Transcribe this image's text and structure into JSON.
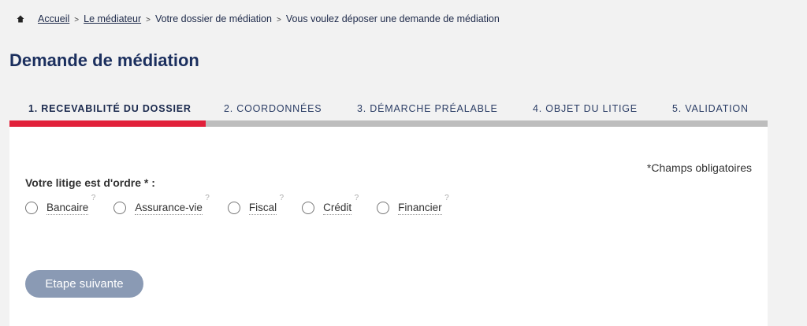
{
  "breadcrumb": {
    "items": [
      {
        "label": "Accueil"
      },
      {
        "label": "Le médiateur"
      },
      {
        "label": "Votre dossier de médiation"
      },
      {
        "label": "Vous voulez déposer une demande de médiation"
      }
    ],
    "separator": ">"
  },
  "page": {
    "title": "Demande de médiation"
  },
  "steps": [
    {
      "label": "1. RECEVABILITÉ DU DOSSIER",
      "active": true
    },
    {
      "label": "2. COORDONNÉES",
      "active": false
    },
    {
      "label": "3. DÉMARCHE PRÉALABLE",
      "active": false
    },
    {
      "label": "4. OBJET DU LITIGE",
      "active": false
    },
    {
      "label": "5. VALIDATION",
      "active": false
    }
  ],
  "form": {
    "required_note": "*Champs obligatoires",
    "question": "Votre litige est d'ordre * :",
    "help_mark": "?",
    "options": [
      {
        "label": "Bancaire"
      },
      {
        "label": "Assurance-vie"
      },
      {
        "label": "Fiscal"
      },
      {
        "label": "Crédit"
      },
      {
        "label": "Financier"
      }
    ],
    "next_label": "Etape suivante"
  },
  "colors": {
    "title": "#1b2f5e",
    "active_step_bar": "#e1203a",
    "inactive_step_bar": "#bdbdbd",
    "next_button": "#8a9ab4",
    "page_background": "#f2f2f2"
  },
  "icons": {
    "home": "home-icon"
  }
}
